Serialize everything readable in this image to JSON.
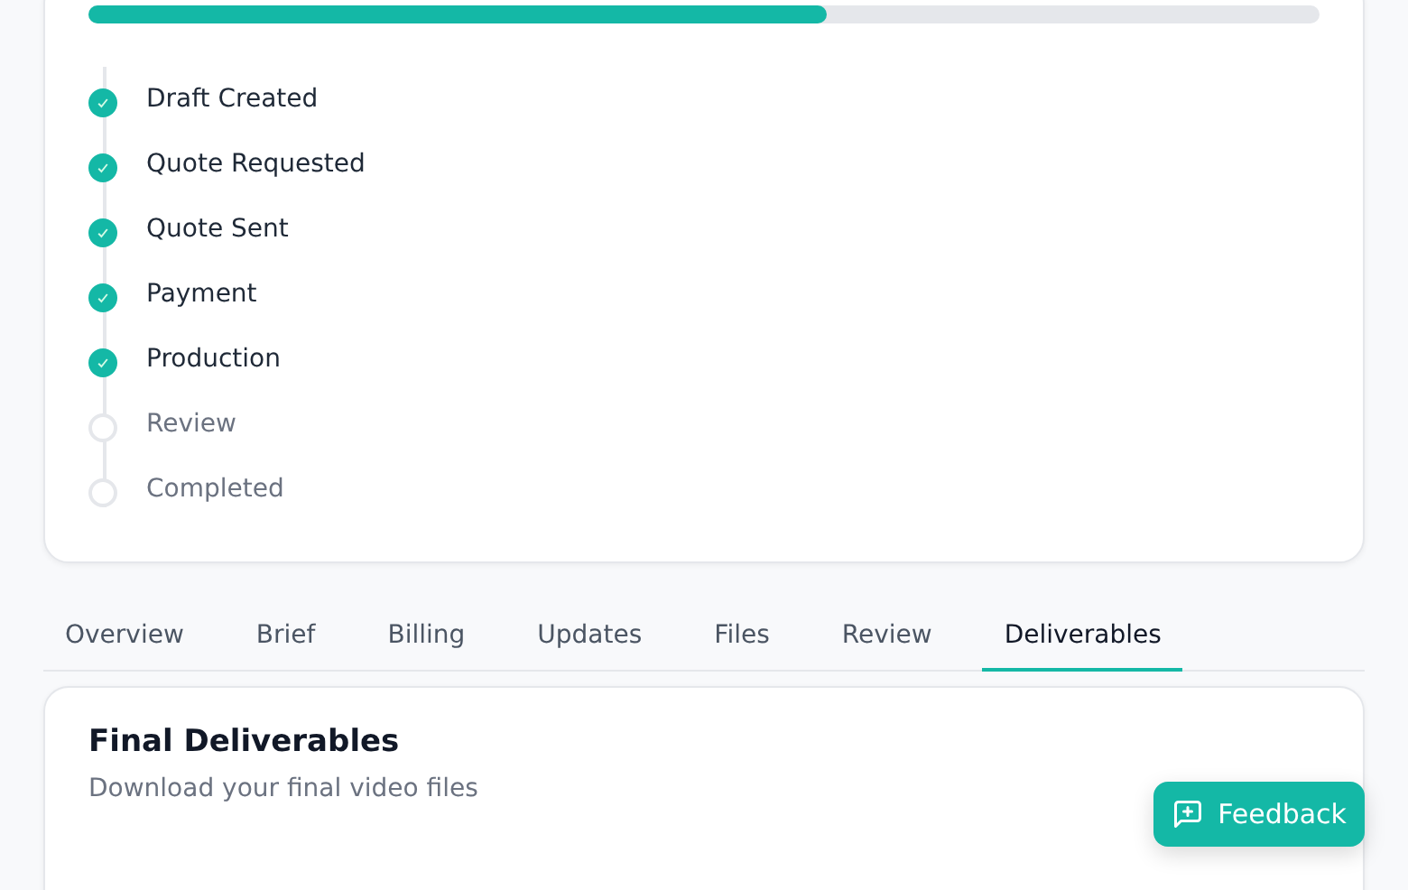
{
  "progress": {
    "level": 0.6
  },
  "steps": [
    {
      "label": "Draft Created",
      "done": true
    },
    {
      "label": "Quote Requested",
      "done": true
    },
    {
      "label": "Quote Sent",
      "done": true
    },
    {
      "label": "Payment",
      "done": true
    },
    {
      "label": "Production",
      "done": true
    },
    {
      "label": "Review",
      "done": false
    },
    {
      "label": "Completed",
      "done": false
    }
  ],
  "tabs": [
    {
      "label": "Overview",
      "selected": false
    },
    {
      "label": "Brief",
      "selected": false
    },
    {
      "label": "Billing",
      "selected": false
    },
    {
      "label": "Updates",
      "selected": false
    },
    {
      "label": "Files",
      "selected": false
    },
    {
      "label": "Review",
      "selected": false
    },
    {
      "label": "Deliverables",
      "selected": true
    }
  ],
  "deliverables": {
    "title": "Final Deliverables",
    "subtitle": "Download your final video files"
  },
  "feedback_button": {
    "label": "Feedback"
  }
}
